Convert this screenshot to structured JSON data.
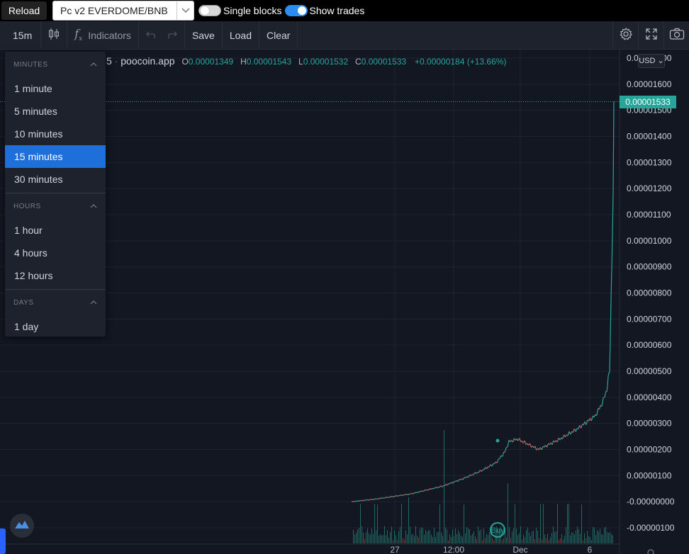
{
  "topbar": {
    "reload_label": "Reload",
    "pair_value": "Pc v2 EVERDOME/BNB",
    "single_blocks_label": "Single blocks",
    "single_blocks_on": false,
    "show_trades_label": "Show trades",
    "show_trades_on": true
  },
  "toolbar": {
    "interval": "15m",
    "indicators_label": "Indicators",
    "save_label": "Save",
    "load_label": "Load",
    "clear_label": "Clear"
  },
  "legend": {
    "symbol_fragment": "5",
    "source": "poocoin.app",
    "o_label": "O",
    "o": "0.00001349",
    "h_label": "H",
    "h": "0.00001543",
    "l_label": "L",
    "l": "0.00001532",
    "c_label": "C",
    "c": "0.00001533",
    "change": "+0.00000184 (+13.66%)"
  },
  "interval_menu": {
    "minutes_header": "MINUTES",
    "minutes": [
      "1 minute",
      "5 minutes",
      "10 minutes",
      "15 minutes",
      "30 minutes"
    ],
    "selected": "15 minutes",
    "hours_header": "HOURS",
    "hours": [
      "1 hour",
      "4 hours",
      "12 hours"
    ],
    "days_header": "DAYS",
    "days": [
      "1 day"
    ]
  },
  "price_axis": {
    "currency": "USD",
    "current_price": "0.00001533",
    "ticks": [
      "0.00001700",
      "0.00001600",
      "0.00001500",
      "0.00001400",
      "0.00001300",
      "0.00001200",
      "0.00001100",
      "0.00001000",
      "0.00000900",
      "0.00000800",
      "0.00000700",
      "0.00000600",
      "0.00000500",
      "0.00000400",
      "0.00000300",
      "0.00000200",
      "0.00000100",
      "-0.00000000",
      "-0.00000100"
    ]
  },
  "time_axis": {
    "ticks": [
      "27",
      "12:00",
      "Dec",
      "6"
    ]
  },
  "markers": {
    "buy_label": "Buy"
  },
  "colors": {
    "up": "#26a69a",
    "down": "#ef5350",
    "background": "#131722",
    "selected": "#1e6fd9",
    "toggle_on": "#2c8df0"
  },
  "chart_data": {
    "type": "line",
    "x": [
      "27",
      "12:00",
      "Dec",
      "6"
    ],
    "series": [
      {
        "values": [
          0.0,
          1e-07,
          3e-07,
          6e-07,
          9e-07,
          1.2e-06,
          1.5e-06,
          1.9e-06,
          2.3e-06,
          2.4e-06,
          2e-06,
          2.4e-06,
          2.8e-06,
          3.3e-06,
          3.8e-06,
          4.3e-06,
          4.7e-06,
          5e-06,
          9e-06,
          1.3e-05,
          1.533e-05
        ]
      }
    ],
    "ylim": [
      -1e-06,
      1.7e-05
    ]
  }
}
